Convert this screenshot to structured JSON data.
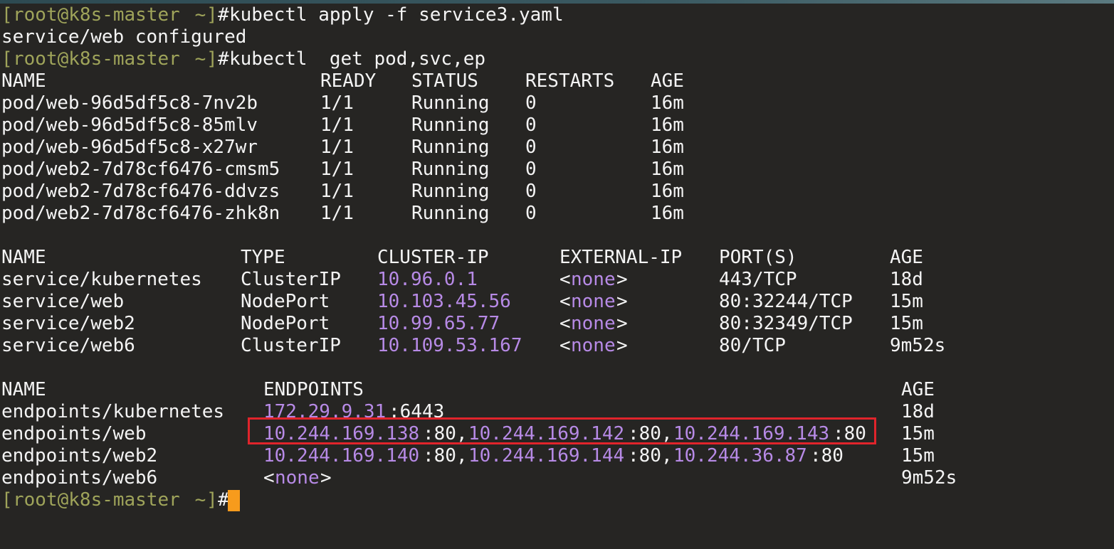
{
  "prompt": {
    "open": "[",
    "user_host": "root@k8s-master",
    "path": " ~",
    "close": "]",
    "hash": "#"
  },
  "commands": {
    "cmd1": "kubectl apply -f service3.yaml",
    "out1": "service/web configured",
    "cmd2": "kubectl  get pod,svc,ep"
  },
  "pods": {
    "headers": [
      "NAME",
      "READY",
      "STATUS",
      "RESTARTS",
      "AGE"
    ],
    "rows": [
      [
        "pod/web-96d5df5c8-7nv2b",
        "1/1",
        "Running",
        "0",
        "16m"
      ],
      [
        "pod/web-96d5df5c8-85mlv",
        "1/1",
        "Running",
        "0",
        "16m"
      ],
      [
        "pod/web-96d5df5c8-x27wr",
        "1/1",
        "Running",
        "0",
        "16m"
      ],
      [
        "pod/web2-7d78cf6476-cmsm5",
        "1/1",
        "Running",
        "0",
        "16m"
      ],
      [
        "pod/web2-7d78cf6476-ddvzs",
        "1/1",
        "Running",
        "0",
        "16m"
      ],
      [
        "pod/web2-7d78cf6476-zhk8n",
        "1/1",
        "Running",
        "0",
        "16m"
      ]
    ]
  },
  "services": {
    "headers": [
      "NAME",
      "TYPE",
      "CLUSTER-IP",
      "EXTERNAL-IP",
      "PORT(S)",
      "AGE"
    ],
    "rows": [
      [
        "service/kubernetes",
        "ClusterIP",
        "10.96.0.1",
        "<",
        "none",
        ">",
        "443/TCP",
        "18d"
      ],
      [
        "service/web",
        "NodePort",
        "10.103.45.56",
        "<",
        "none",
        ">",
        "80:32244/TCP",
        "15m"
      ],
      [
        "service/web2",
        "NodePort",
        "10.99.65.77",
        "<",
        "none",
        ">",
        "80:32349/TCP",
        "15m"
      ],
      [
        "service/web6",
        "ClusterIP",
        "10.109.53.167",
        "<",
        "none",
        ">",
        "80/TCP",
        "9m52s"
      ]
    ]
  },
  "endpoints": {
    "headers": [
      "NAME",
      "ENDPOINTS",
      "AGE"
    ],
    "rows": [
      {
        "name": "endpoints/kubernetes",
        "parts": [
          "172.29.9.31",
          ":6443"
        ],
        "age": "18d"
      },
      {
        "name": "endpoints/web",
        "parts": [
          "10.244.169.138",
          ":80,",
          "10.244.169.142",
          ":80,",
          "10.244.169.143",
          ":80"
        ],
        "age": "15m"
      },
      {
        "name": "endpoints/web2",
        "parts": [
          "10.244.169.140",
          ":80,",
          "10.244.169.144",
          ":80,",
          "10.244.36.87",
          ":80"
        ],
        "age": "15m"
      },
      {
        "name": "endpoints/web6",
        "parts": [
          "<",
          "none",
          ">"
        ],
        "age": "9m52s"
      }
    ]
  },
  "colors": {
    "background": "#262523",
    "text": "#f4f4f4",
    "prompt": "#9fa45a",
    "ip": "#b78ae6",
    "cursor": "#f79b1c",
    "highlight_box": "#e0242b"
  }
}
